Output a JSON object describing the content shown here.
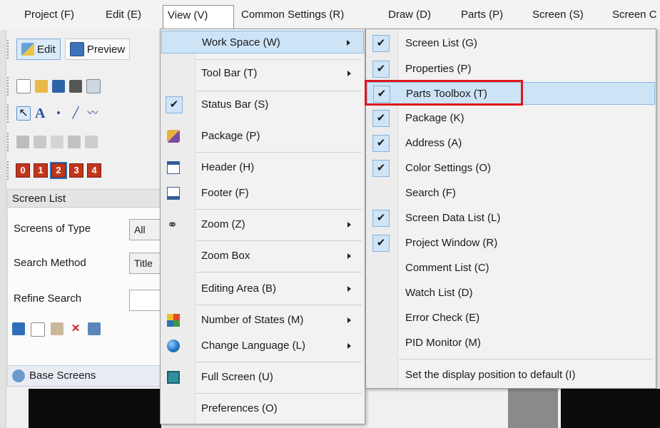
{
  "menubar": {
    "items": [
      {
        "label": "Project (F)"
      },
      {
        "label": "Edit (E)"
      },
      {
        "label": "View (V)"
      },
      {
        "label": "Common Settings (R)"
      },
      {
        "label": "Draw (D)"
      },
      {
        "label": "Parts (P)"
      },
      {
        "label": "Screen (S)"
      },
      {
        "label": "Screen C"
      }
    ]
  },
  "toolbar": {
    "edit_label": "Edit",
    "preview_label": "Preview",
    "state_numbers": [
      "0",
      "1",
      "2",
      "3",
      "4"
    ]
  },
  "screen_list_panel": {
    "title": "Screen List",
    "screens_of_type_label": "Screens of Type",
    "screens_of_type_value": "All",
    "search_method_label": "Search Method",
    "search_method_value": "Title",
    "refine_search_label": "Refine Search",
    "refine_search_value": "",
    "base_screens_label": "Base Screens"
  },
  "view_menu": {
    "items": [
      {
        "label": "Work Space (W)",
        "submenu": true,
        "highlighted": true
      },
      {
        "label": "Tool Bar (T)",
        "submenu": true
      },
      {
        "label": "Status Bar (S)",
        "checked": true
      },
      {
        "label": "Package (P)",
        "icon": "package-icon"
      },
      {
        "label": "Header (H)",
        "icon": "header-icon"
      },
      {
        "label": "Footer (F)",
        "icon": "footer-icon"
      },
      {
        "label": "Zoom (Z)",
        "submenu": true,
        "icon": "binoculars-icon"
      },
      {
        "label": "Zoom Box",
        "submenu": true
      },
      {
        "label": "Editing Area (B)",
        "submenu": true
      },
      {
        "label": "Number of States (M)",
        "submenu": true,
        "icon": "states-icon"
      },
      {
        "label": "Change Language (L)",
        "submenu": true,
        "icon": "globe-icon"
      },
      {
        "label": "Full Screen (U)",
        "icon": "fullscreen-icon"
      },
      {
        "label": "Preferences (O)"
      }
    ]
  },
  "workspace_menu": {
    "items": [
      {
        "label": "Screen List (G)",
        "checked": true
      },
      {
        "label": "Properties (P)",
        "checked": true
      },
      {
        "label": "Parts Toolbox (T)",
        "checked": true,
        "highlighted": true
      },
      {
        "label": "Package (K)",
        "checked": true
      },
      {
        "label": "Address (A)",
        "checked": true
      },
      {
        "label": "Color Settings (O)",
        "checked": true
      },
      {
        "label": "Search (F)",
        "checked": false
      },
      {
        "label": "Screen Data List (L)",
        "checked": true
      },
      {
        "label": "Project Window (R)",
        "checked": true
      },
      {
        "label": "Comment List (C)",
        "checked": false
      },
      {
        "label": "Watch List (D)",
        "checked": false
      },
      {
        "label": "Error Check (E)",
        "checked": false
      },
      {
        "label": "PID Monitor (M)",
        "checked": false
      },
      {
        "label": "Set the display position to default (I)",
        "checked": false
      }
    ],
    "check_glyph": "✔"
  },
  "colors": {
    "highlight": "#cde4f7",
    "annotation_red": "#e0151a"
  }
}
